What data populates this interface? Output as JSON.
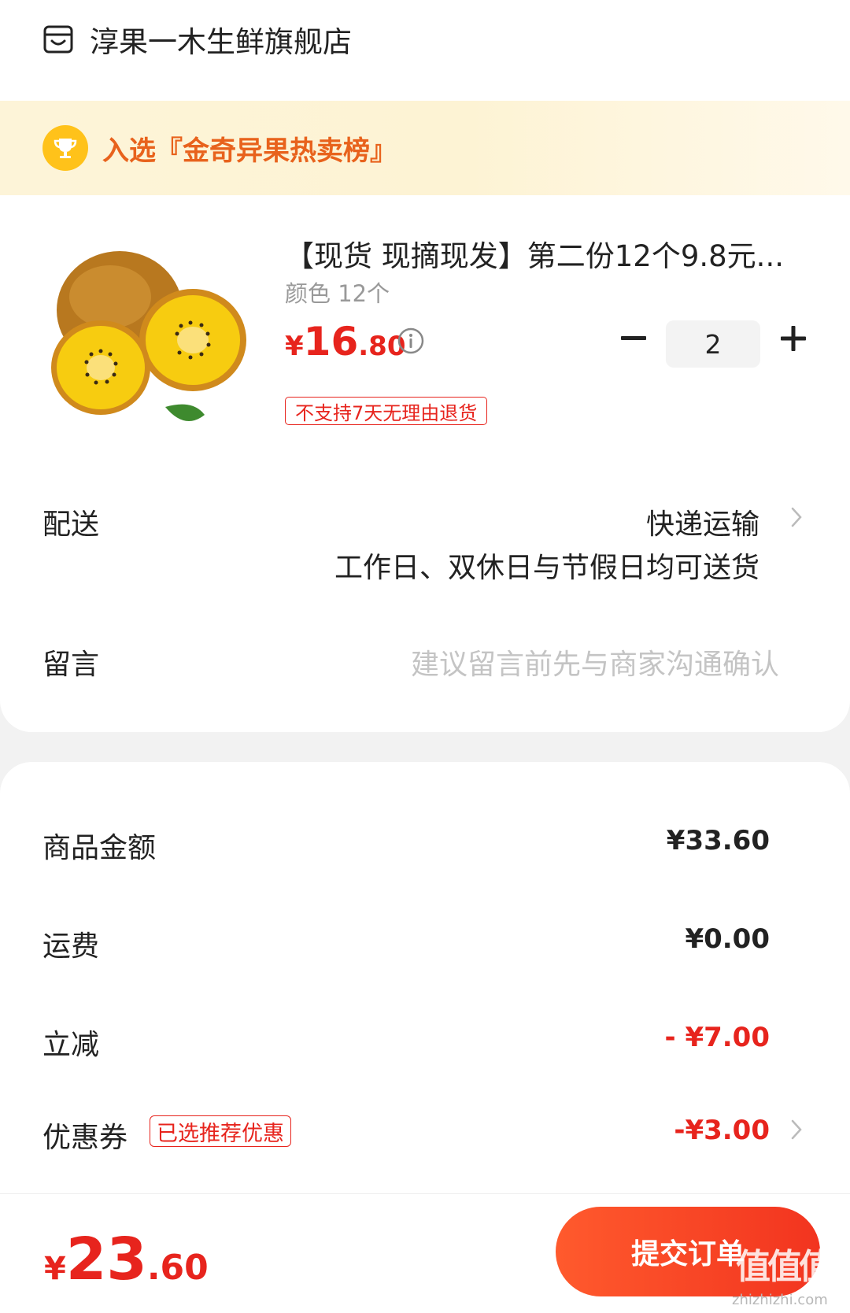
{
  "store": {
    "name": "淳果一木生鲜旗舰店"
  },
  "rank_banner": {
    "text": "入选『金奇异果热卖榜』"
  },
  "product": {
    "title": "【现货 现摘现发】第二份12个9.8元...",
    "spec": "颜色 12个",
    "price_currency": "¥",
    "price_integer": "16",
    "price_decimal": ".80",
    "quantity": "2",
    "return_policy": "不支持7天无理由退货"
  },
  "delivery": {
    "label": "配送",
    "method": "快递运输",
    "note": "工作日、双休日与节假日均可送货"
  },
  "remark": {
    "label": "留言",
    "placeholder": "建议留言前先与商家沟通确认"
  },
  "summary": {
    "goods_label": "商品金额",
    "goods_amount": "¥33.60",
    "shipping_label": "运费",
    "shipping_amount": "¥0.00",
    "discount_label": "立减",
    "discount_amount": "- ¥7.00",
    "coupon_label": "优惠券",
    "coupon_badge": "已选推荐优惠",
    "coupon_amount": "-¥3.00"
  },
  "footer": {
    "total_currency": "¥",
    "total_integer": "23",
    "total_decimal": ".60",
    "submit_label": "提交订单",
    "watermark": "值值值",
    "watermark_site": "zhizhizhi.com"
  },
  "colors": {
    "accent_red": "#e7241d",
    "banner_text": "#e8621c",
    "trophy": "#ffc21a"
  }
}
